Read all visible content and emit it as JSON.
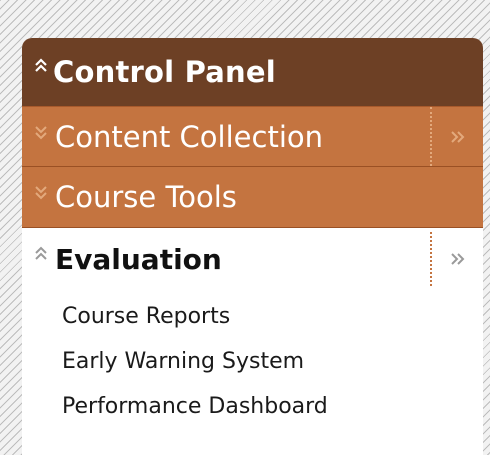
{
  "panel": {
    "title": "Control Panel",
    "header_icon": "double-chevron-up-icon",
    "sections": [
      {
        "label": "Content Collection",
        "icon": "double-chevron-down-icon",
        "expand_icon": "double-chevron-right-icon"
      },
      {
        "label": "Course Tools",
        "icon": "double-chevron-down-icon"
      },
      {
        "label": "Evaluation",
        "icon": "double-chevron-up-icon",
        "expand_icon": "double-chevron-right-icon"
      }
    ],
    "evaluation_items": [
      "Course Reports",
      "Early Warning System",
      "Performance Dashboard"
    ]
  },
  "glyphs": {
    "up": "⌃",
    "down": "⌄",
    "right": "»"
  },
  "colors": {
    "header_bg": "#6d4025",
    "section_bg": "#c47440",
    "text_light": "#ffffff",
    "text_dark": "#111111"
  }
}
